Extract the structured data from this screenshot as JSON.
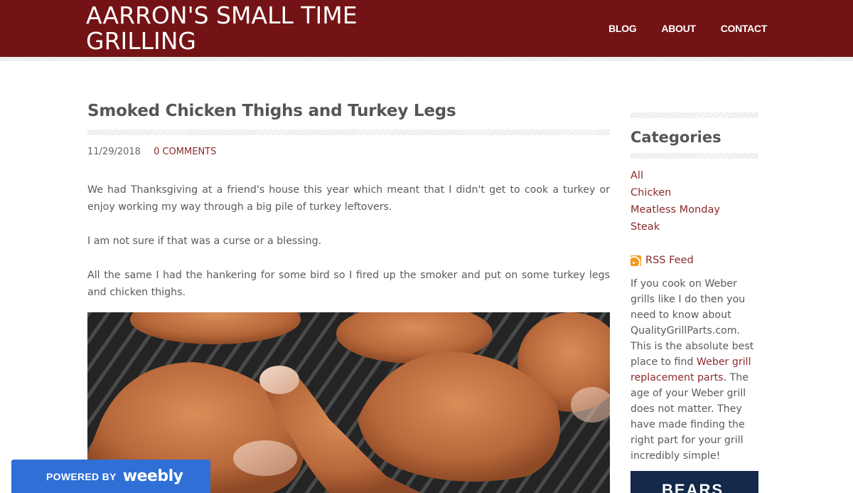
{
  "site": {
    "title": "AARRON'S SMALL TIME GRILLING"
  },
  "nav": {
    "items": [
      {
        "label": "BLOG"
      },
      {
        "label": "ABOUT"
      },
      {
        "label": "CONTACT"
      }
    ]
  },
  "post": {
    "title": "Smoked Chicken Thighs and Turkey Legs",
    "date": "11/29/2018",
    "comments": "0 COMMENTS",
    "paragraphs": [
      "We had Thanksgiving at a friend's house this year which meant that I didn't get to cook a turkey or enjoy working my way through a big pile of turkey leftovers.",
      "I am not sure if that was a curse or a blessing.",
      "All the same I had the hankering for some bird so I fired up the smoker and put on some turkey legs and chicken thighs."
    ]
  },
  "sidebar": {
    "categories_title": "Categories",
    "categories": [
      {
        "label": "All"
      },
      {
        "label": "Chicken"
      },
      {
        "label": "Meatless Monday"
      },
      {
        "label": "Steak"
      }
    ],
    "rss_label": "RSS Feed",
    "promo": {
      "text_before": "If you cook on Weber grills like I do then you need to know about QualityGrillParts.com. This is the absolute best place to find ",
      "link": "Weber grill replacement parts",
      "text_after": ". The age of your Weber grill does not matter. They have made finding the right part for your grill incredibly simple!"
    },
    "ad_text": "BEARS"
  },
  "badge": {
    "powered": "POWERED BY",
    "brand": "weebly"
  },
  "colors": {
    "header": "#741315",
    "link": "#8c2a2c",
    "badge": "#2f6fd6"
  },
  "icons": {
    "rss": "rss-icon"
  }
}
